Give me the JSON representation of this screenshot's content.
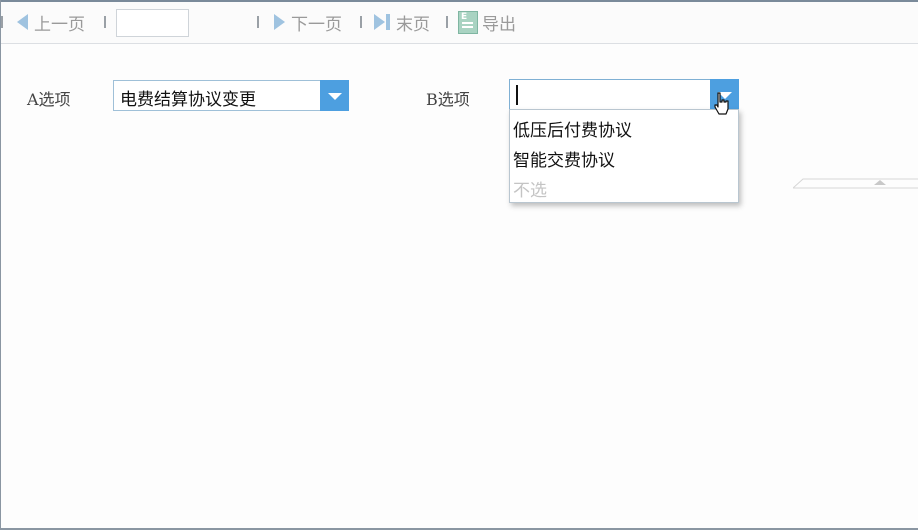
{
  "toolbar": {
    "prev_label": "上一页",
    "page_input_value": "",
    "next_label": "下一页",
    "last_label": "末页",
    "export_label": "导出"
  },
  "form": {
    "a_label": "A选项",
    "a_value": "电费结算协议变更",
    "b_label": "B选项",
    "b_value": ""
  },
  "dropdown": {
    "options": [
      "低压后付费协议",
      "智能交费协议",
      "不选"
    ]
  },
  "colors": {
    "accent": "#4d9fe0",
    "nav_icon": "#9fc3e0",
    "disabled_text": "#c4c4c4"
  }
}
